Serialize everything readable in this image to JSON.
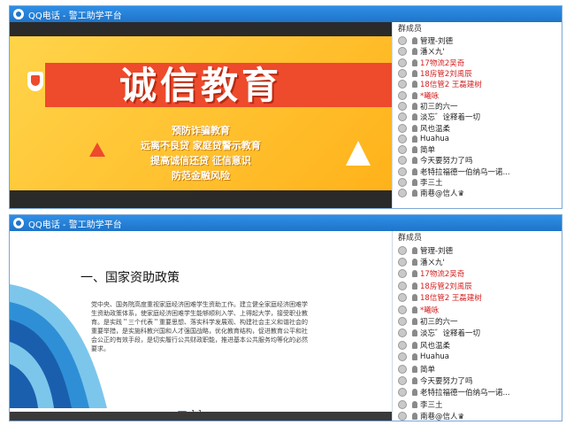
{
  "window_title": "QQ电话 - 警工助学平台",
  "slide1": {
    "title": "诚信教育",
    "lines": [
      "预防诈骗教育",
      "远离不良贷 家庭贷警示教育",
      "提高诚信还贷 征信意识",
      "防范金融风险"
    ]
  },
  "slide2": {
    "heading": "一、国家资助政策",
    "paragraph": "党中央、国务院高度重视家庭经济困难学生资助工作。建立健全家庭经济困难学生资助政策体系，使家庭经济困难学生能够顺利入学、上得起大学，接受职业教育。是实践＂三个代表＂重要思想、落实科学发展观、构建社会主义和谐社会的重要举措，是实施科教兴国和人才强国战略，优化教育结构，促进教育公平和社会公正的有效手段，是切实履行公共财政职能，推进基本公共服务均等化的必然要求。",
    "page_indicator": "1:1"
  },
  "panel": {
    "header": "群成员",
    "members": [
      {
        "name": "管理-刘德",
        "red": false
      },
      {
        "name": "潘ㄨ九'",
        "red": false
      },
      {
        "name": "17物流2吴奇",
        "red": true
      },
      {
        "name": "18房管2刘禹辰",
        "red": true
      },
      {
        "name": "18信管2 王磊建树",
        "red": true
      },
      {
        "name": "*曦咏",
        "red": true
      },
      {
        "name": "初三的六一",
        "red": false
      },
      {
        "name": "淡忘゛诠释着一切",
        "red": false
      },
      {
        "name": "风也温柔",
        "red": false
      },
      {
        "name": "Huahua",
        "red": false
      },
      {
        "name": "简单",
        "red": false
      },
      {
        "name": "今天要努力了吗",
        "red": false
      },
      {
        "name": "老特拉福德一伯纳乌一诺...",
        "red": false
      },
      {
        "name": "李三土",
        "red": false
      },
      {
        "name": "南巷@信人♛",
        "red": false
      }
    ]
  }
}
